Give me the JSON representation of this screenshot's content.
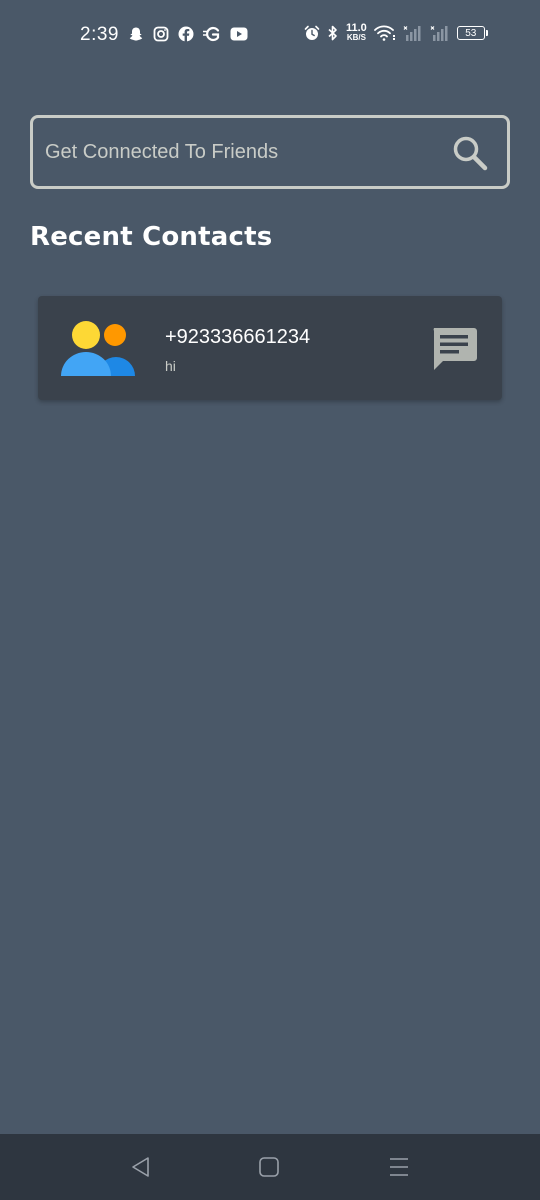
{
  "status_bar": {
    "time": "2:39",
    "net_speed_value": "11.0",
    "net_speed_unit": "KB/S",
    "battery_level": "53",
    "icons_left": [
      "snapchat-icon",
      "instagram-icon",
      "facebook-icon",
      "g-icon",
      "youtube-icon"
    ],
    "icons_right": [
      "alarm-icon",
      "bluetooth-icon",
      "wifi-icon",
      "signal-icon",
      "signal-icon",
      "battery-icon"
    ]
  },
  "search": {
    "placeholder": "Get Connected To Friends",
    "value": ""
  },
  "recent": {
    "title": "Recent Contacts",
    "contacts": [
      {
        "name": "+923336661234",
        "last_message": "hi"
      }
    ]
  },
  "nav": {
    "buttons": [
      "back",
      "home",
      "recents"
    ]
  },
  "colors": {
    "background": "#4a5868",
    "card": "#3a424c",
    "border": "#c9ccc7",
    "nav_bar": "#2e3640",
    "avatar_yellow": "#fdd835",
    "avatar_orange": "#ff9800",
    "avatar_blue_light": "#42a5f5",
    "avatar_blue_dark": "#1e88e5"
  }
}
